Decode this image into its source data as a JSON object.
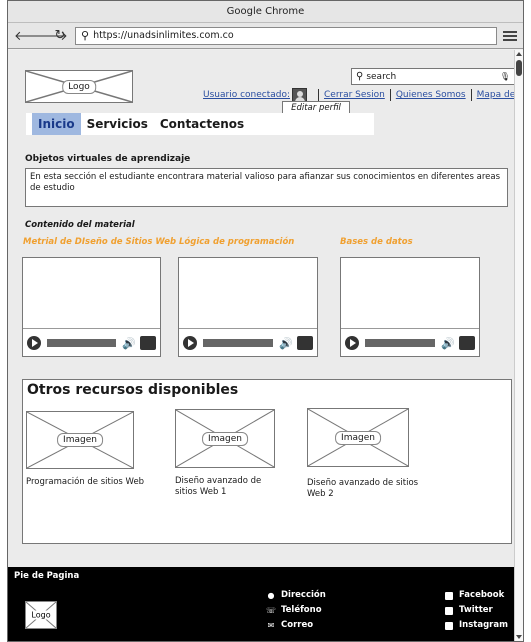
{
  "browser": {
    "title": "Google Chrome",
    "url": "https://unadsinlimites.com.co",
    "icons": [
      "back-icon",
      "forward-icon",
      "reload-icon",
      "search-icon",
      "menu-icon"
    ]
  },
  "header": {
    "logo_label": "Logo",
    "search_placeholder": "search",
    "user_label": "Usuario conectado:",
    "links": [
      "Cerrar Sesion",
      "Quienes Somos",
      "Mapa del Sitio"
    ],
    "dropdown": "Editar perfil"
  },
  "nav": {
    "items": [
      "Inicio",
      "Servicios",
      "Contactenos"
    ],
    "active": "Inicio"
  },
  "main": {
    "section_title": "Objetos virtuales de aprendizaje",
    "description": "En esta sección el estudiante encontrara material valioso para afianzar sus conocimientos en diferentes areas de estudio",
    "content_title": "Contenido del material",
    "videos": [
      {
        "title": "Metrial de DIseño de Sitios Web"
      },
      {
        "title": "Lógica de programación"
      },
      {
        "title": "Bases de datos"
      }
    ]
  },
  "resources": {
    "title": "Otros recursos disponibles",
    "items": [
      {
        "image_label": "Imagen",
        "caption": "Programación de sitios Web"
      },
      {
        "image_label": "Imagen",
        "caption": "Diseño avanzado de sitios Web 1"
      },
      {
        "image_label": "Imagen",
        "caption": "Diseño avanzado de sitios Web 2"
      }
    ]
  },
  "footer": {
    "title": "Pie de Pagina",
    "logo_label": "Logo",
    "contact": [
      "Dirección",
      "Teléfono",
      "Correo"
    ],
    "social": [
      "Facebook",
      "Twitter",
      "Instagram"
    ]
  },
  "colors": {
    "accent_orange": "#f0a030",
    "link_blue": "#2a4ea0",
    "nav_active_bg": "#9fb8e0"
  }
}
